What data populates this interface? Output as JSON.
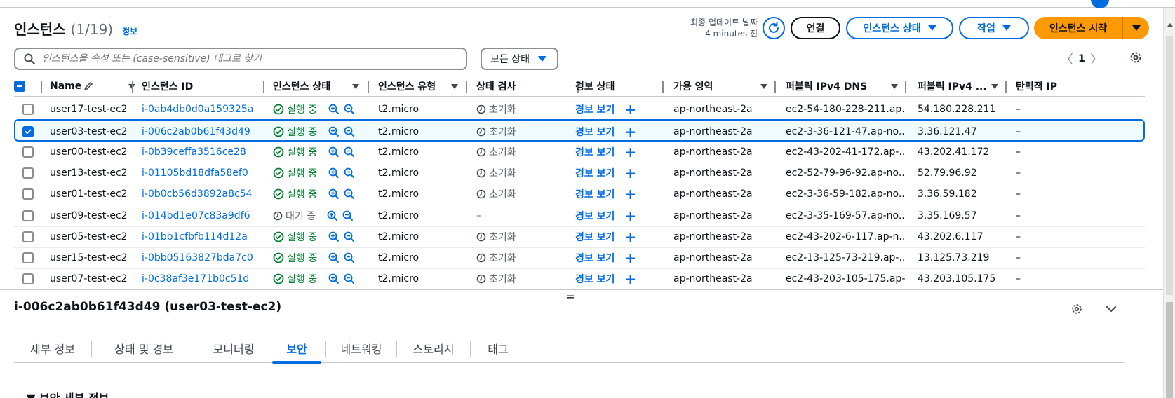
{
  "colors": {
    "primary": "#006ce0",
    "running": "#00802f",
    "launch": "#ff9900"
  },
  "header": {
    "title": "인스턴스",
    "count": "(1/19)",
    "info_link": "정보",
    "last_updated_label": "최종 업데이트 날짜",
    "last_updated_value": "4 minutes 전",
    "connect_label": "연결",
    "instance_state_label": "인스턴스 상태",
    "actions_label": "작업",
    "launch_label": "인스턴스 시작"
  },
  "filter": {
    "search_placeholder": "인스턴스을 속성 또는 (case-sensitive) 태그로 찾기",
    "state_filter_label": "모든 상태",
    "page_number": "1"
  },
  "table": {
    "columns": [
      "Name",
      "인스턴스 ID",
      "인스턴스 상태",
      "인스턴스 유형",
      "상태 검사",
      "경보 상태",
      "가용 영역",
      "퍼블릭 IPv4 DNS",
      "퍼블릭 IPv4 ...",
      "탄력적 IP"
    ],
    "rows": [
      {
        "name": "user17-test-ec2",
        "id": "i-0ab4db0d0a159325a",
        "state": "실행 중",
        "running": true,
        "type": "t2.micro",
        "check": "초기화",
        "alarm": "경보 보기",
        "az": "ap-northeast-2a",
        "dns": "ec2-54-180-228-211.ap...",
        "ip": "54.180.228.211",
        "eip": "–",
        "selected": false
      },
      {
        "name": "user03-test-ec2",
        "id": "i-006c2ab0b61f43d49",
        "state": "실행 중",
        "running": true,
        "type": "t2.micro",
        "check": "초기화",
        "alarm": "경보 보기",
        "az": "ap-northeast-2a",
        "dns": "ec2-3-36-121-47.ap-no...",
        "ip": "3.36.121.47",
        "eip": "–",
        "selected": true
      },
      {
        "name": "user00-test-ec2",
        "id": "i-0b39ceffa3516ce28",
        "state": "실행 중",
        "running": true,
        "type": "t2.micro",
        "check": "초기화",
        "alarm": "경보 보기",
        "az": "ap-northeast-2a",
        "dns": "ec2-43-202-41-172.ap-...",
        "ip": "43.202.41.172",
        "eip": "–",
        "selected": false
      },
      {
        "name": "user13-test-ec2",
        "id": "i-01105bd18dfa58ef0",
        "state": "실행 중",
        "running": true,
        "type": "t2.micro",
        "check": "초기화",
        "alarm": "경보 보기",
        "az": "ap-northeast-2a",
        "dns": "ec2-52-79-96-92.ap-no...",
        "ip": "52.79.96.92",
        "eip": "–",
        "selected": false
      },
      {
        "name": "user01-test-ec2",
        "id": "i-0b0cb56d3892a8c54",
        "state": "실행 중",
        "running": true,
        "type": "t2.micro",
        "check": "초기화",
        "alarm": "경보 보기",
        "az": "ap-northeast-2a",
        "dns": "ec2-3-36-59-182.ap-no...",
        "ip": "3.36.59.182",
        "eip": "–",
        "selected": false
      },
      {
        "name": "user09-test-ec2",
        "id": "i-014bd1e07c83a9df6",
        "state": "대기 중",
        "running": false,
        "type": "t2.micro",
        "check": "–",
        "alarm": "경보 보기",
        "az": "ap-northeast-2a",
        "dns": "ec2-3-35-169-57.ap-no...",
        "ip": "3.35.169.57",
        "eip": "–",
        "selected": false
      },
      {
        "name": "user05-test-ec2",
        "id": "i-01bb1cfbfb114d12a",
        "state": "실행 중",
        "running": true,
        "type": "t2.micro",
        "check": "초기화",
        "alarm": "경보 보기",
        "az": "ap-northeast-2a",
        "dns": "ec2-43-202-6-117.ap-n...",
        "ip": "43.202.6.117",
        "eip": "–",
        "selected": false
      },
      {
        "name": "user15-test-ec2",
        "id": "i-0bb05163827bda7c0",
        "state": "실행 중",
        "running": true,
        "type": "t2.micro",
        "check": "초기화",
        "alarm": "경보 보기",
        "az": "ap-northeast-2a",
        "dns": "ec2-13-125-73-219.ap-...",
        "ip": "13.125.73.219",
        "eip": "–",
        "selected": false
      },
      {
        "name": "user07-test-ec2",
        "id": "i-0c38af3e171b0c51d",
        "state": "실행 중",
        "running": true,
        "type": "t2.micro",
        "check": "초기화",
        "alarm": "경보 보기",
        "az": "ap-northeast-2a",
        "dns": "ec2-43-203-105-175.ap-...",
        "ip": "43.203.105.175",
        "eip": "–",
        "selected": false
      }
    ]
  },
  "detail": {
    "title": "i-006c2ab0b61f43d49 (user03-test-ec2)",
    "tabs": [
      "세부 정보",
      "상태 및 경보",
      "모니터링",
      "보안",
      "네트워킹",
      "스토리지",
      "태그"
    ],
    "active_tab": "보안",
    "section_heading": "▼ 보안 세부 정보"
  }
}
